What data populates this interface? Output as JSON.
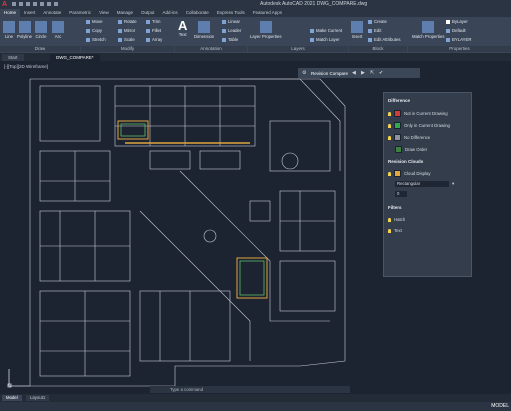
{
  "app": {
    "title": "Autodesk AutoCAD 2021   DWG_COMPARE.dwg"
  },
  "menu": {
    "tabs": [
      "Home",
      "Insert",
      "Annotate",
      "Parametric",
      "View",
      "Manage",
      "Output",
      "Add-ins",
      "Collaborate",
      "Express Tools",
      "Featured Apps"
    ]
  },
  "ribbon": {
    "draw": {
      "title": "Draw",
      "tools": [
        "Line",
        "Polyline",
        "Circle",
        "Arc"
      ]
    },
    "modify": {
      "title": "Modify",
      "tools": [
        "Move",
        "Rotate",
        "Trim",
        "Copy",
        "Mirror",
        "Fillet",
        "Stretch",
        "Scale",
        "Array"
      ]
    },
    "annotation": {
      "title": "Annotation",
      "tools": [
        "Text",
        "Dimension",
        "Linear",
        "Leader",
        "Table"
      ]
    },
    "layers": {
      "title": "Layers",
      "tools": [
        "Layer Properties",
        "Make Current",
        "Match Layer"
      ]
    },
    "block": {
      "title": "Block",
      "tools": [
        "Insert",
        "Create",
        "Edit",
        "Edit Attributes"
      ]
    },
    "properties": {
      "title": "Properties",
      "tools": [
        "Match Properties",
        "ByLayer",
        "Default",
        "BYLAYER"
      ]
    }
  },
  "doctabs": [
    "Start",
    "DWG_COMPARE*"
  ],
  "viewport": {
    "label": "[-][Top][2D Wireframe]"
  },
  "compare_toolbar": {
    "label": "Revision Compare"
  },
  "compare_panel": {
    "difference_title": "Difference",
    "difference_items": [
      {
        "label": "Not in Current Drawing",
        "color": "#d33a3a"
      },
      {
        "label": "Only in Current Drawing",
        "color": "#2fa84f"
      },
      {
        "label": "No Difference",
        "color": "#8f949c"
      },
      {
        "label": "Draw Order",
        "color": "#3f7f3f"
      }
    ],
    "revision_title": "Revision Clouds",
    "cloud_display": {
      "label": "Cloud Display",
      "color": "#e0a640"
    },
    "cloud_shape": "Rectangular",
    "cloud_value": "0",
    "filters_title": "Filters",
    "filters": [
      "Hatch",
      "Text"
    ]
  },
  "commandline": {
    "placeholder": "Type a command"
  },
  "layouts": [
    "Model",
    "Layout1"
  ],
  "status": {
    "mode": "MODEL"
  }
}
